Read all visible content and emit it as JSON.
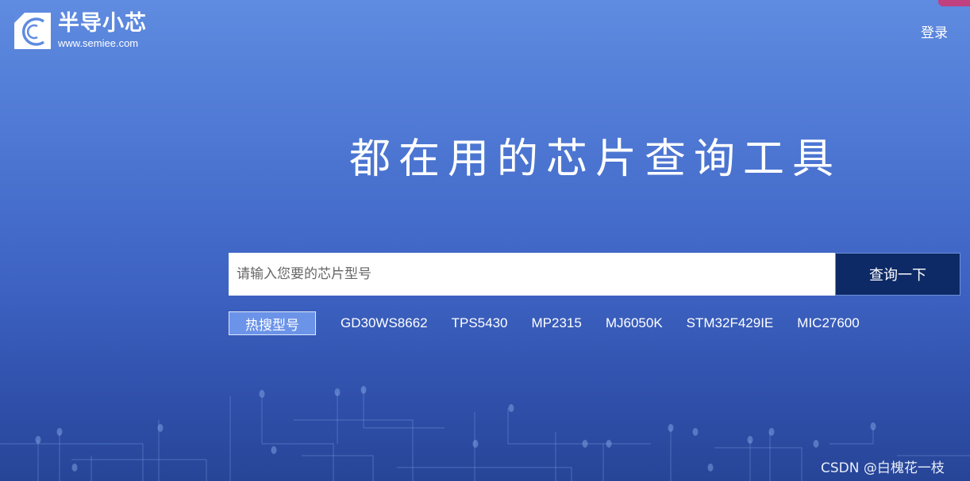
{
  "brand": {
    "name": "半导小芯",
    "url": "www.semiee.com"
  },
  "header": {
    "login_label": "登录"
  },
  "hero": {
    "headline": "都在用的芯片查询工具"
  },
  "search": {
    "placeholder": "请输入您要的芯片型号",
    "value": "",
    "button_label": "查询一下"
  },
  "hot": {
    "label": "热搜型号",
    "items": [
      "GD30WS8662",
      "TPS5430",
      "MP2315",
      "MJ6050K",
      "STM32F429IE",
      "MIC27600"
    ]
  },
  "watermark": "CSDN @白槐花一枝",
  "colors": {
    "search_button": "#0d2a66",
    "hot_label_bg": "#6b93e8",
    "background_top": "#5f8be0",
    "background_bottom": "#274597"
  }
}
